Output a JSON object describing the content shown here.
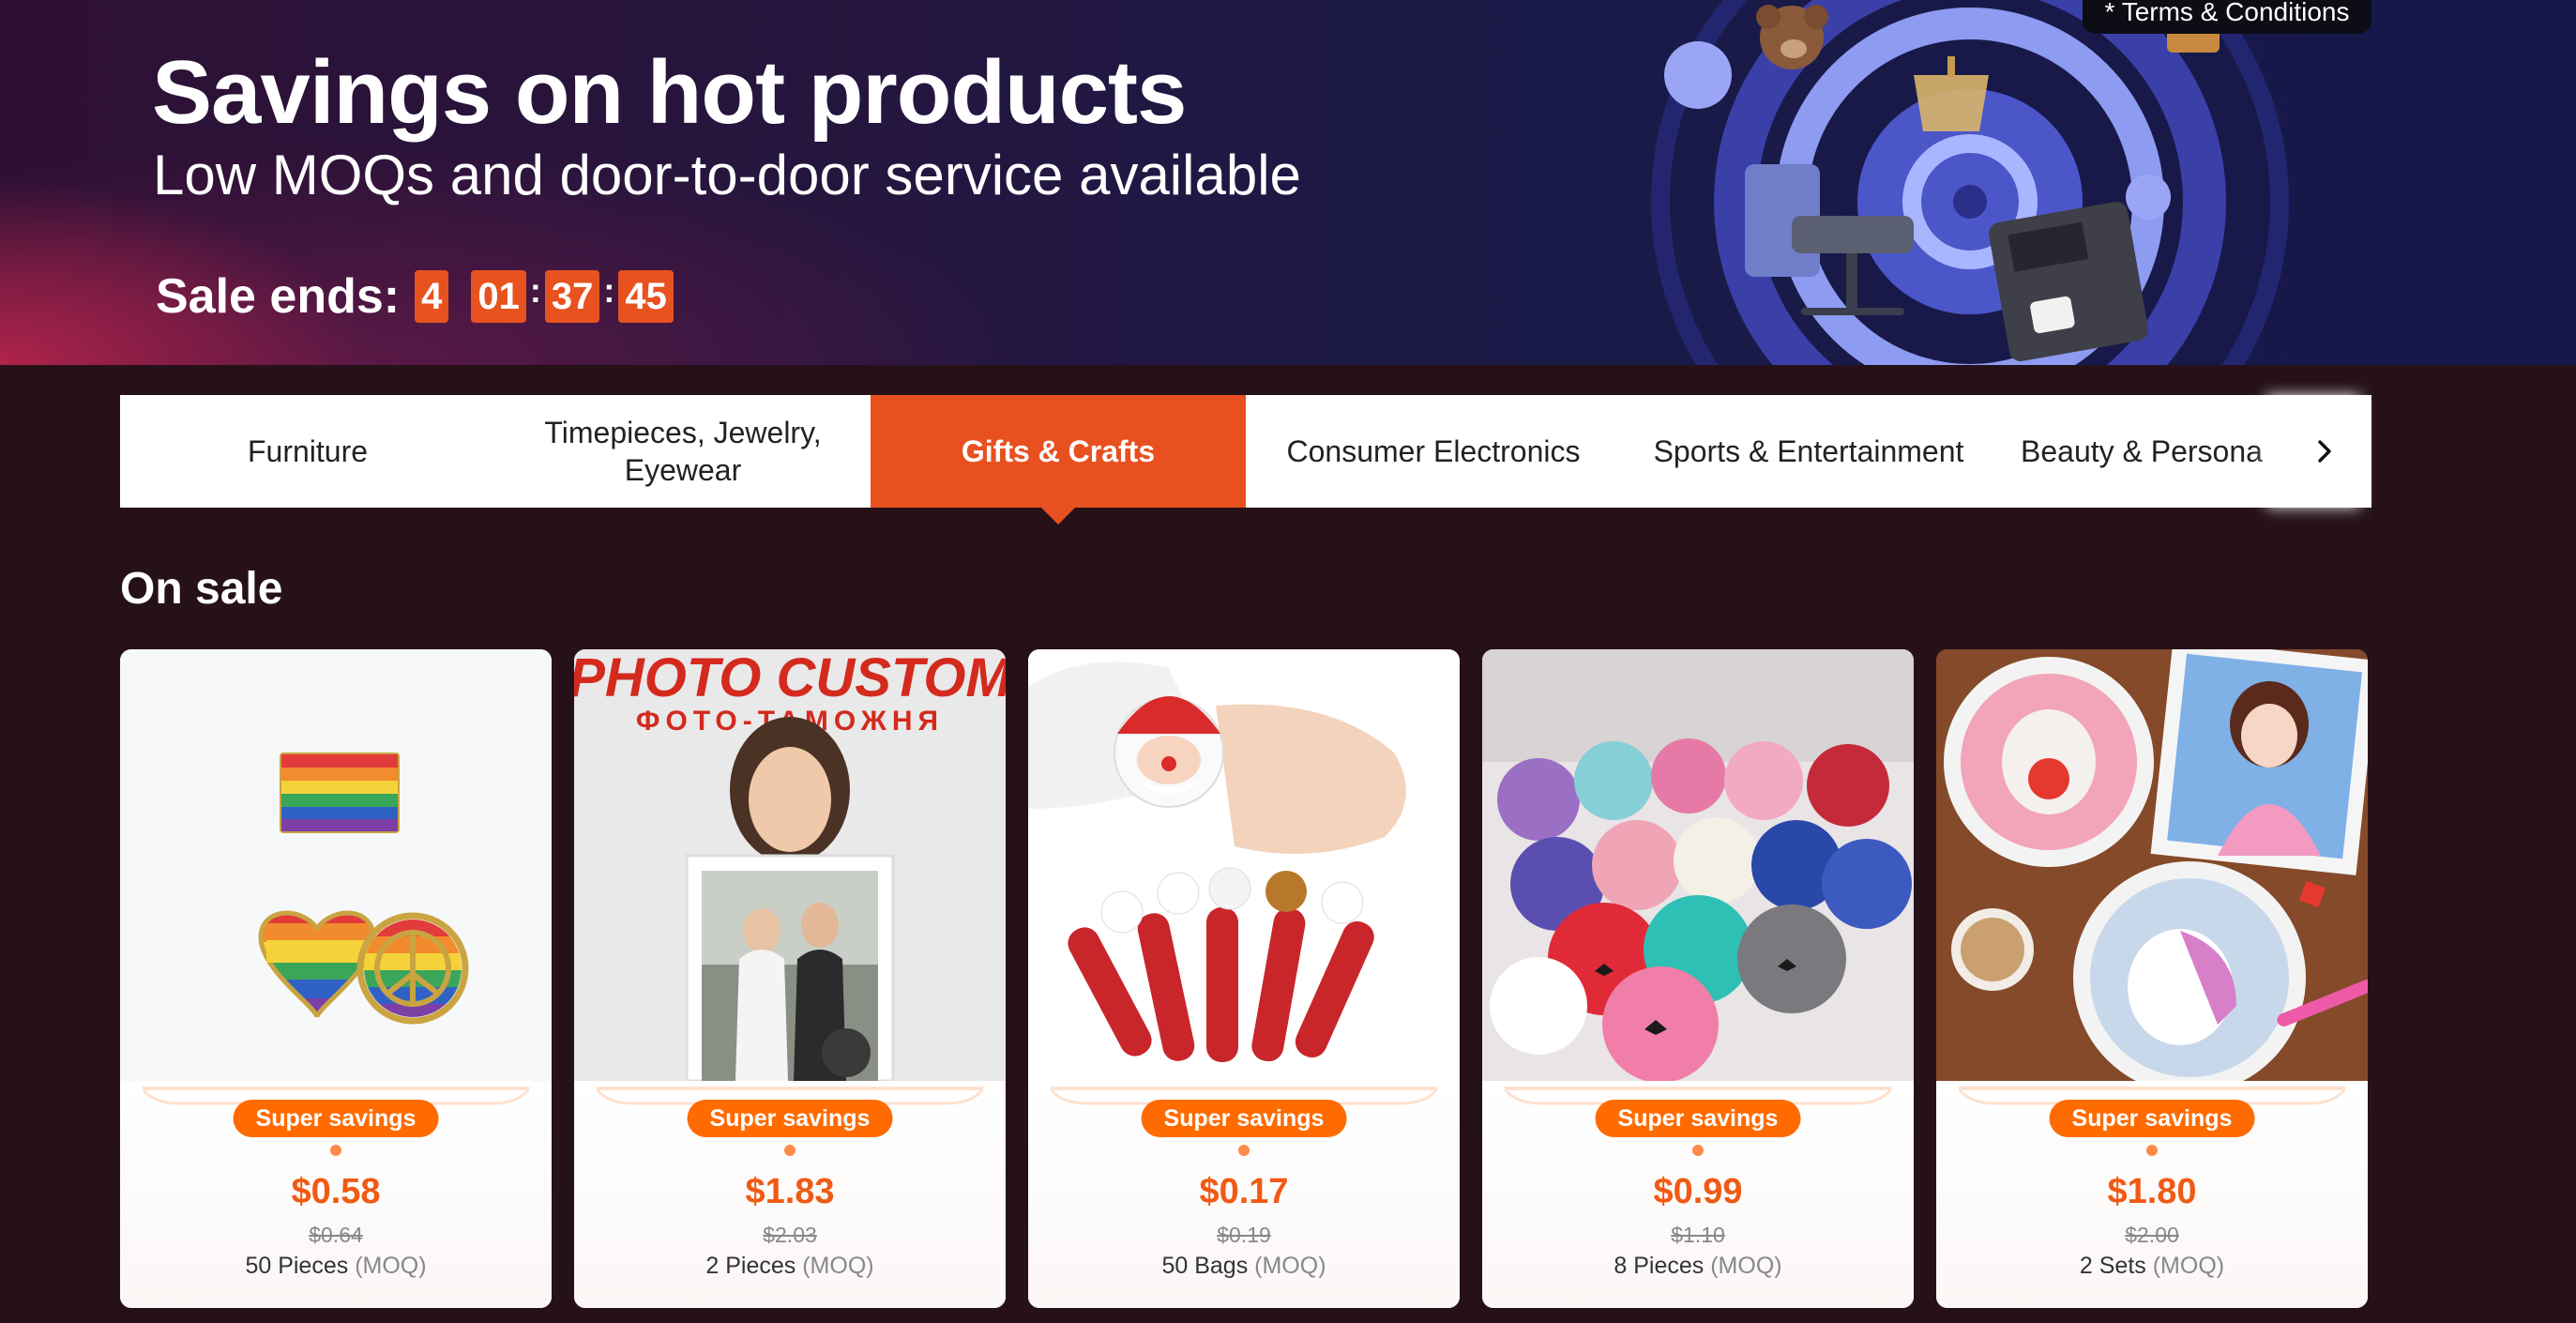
{
  "banner": {
    "title": "Savings on hot products",
    "subtitle": "Low MOQs and door-to-door service available",
    "countdown": {
      "label": "Sale ends:",
      "days": "4",
      "hours": "01",
      "minutes": "37",
      "seconds": "45",
      "separator": ":"
    },
    "terms": "* Terms & Conditions"
  },
  "categories": [
    {
      "label": "Furniture",
      "active": false
    },
    {
      "label": "Timepieces, Jewelry, Eyewear",
      "active": false
    },
    {
      "label": "Gifts & Crafts",
      "active": true
    },
    {
      "label": "Consumer Electronics",
      "active": false
    },
    {
      "label": "Sports & Entertainment",
      "active": false
    },
    {
      "label": "Beauty & Persona",
      "active": false
    }
  ],
  "section": {
    "title": "On sale"
  },
  "products": [
    {
      "badge": "Super savings",
      "price": "$0.58",
      "old_price": "$0.64",
      "moq": "50 Pieces",
      "moq_tag": "(MOQ)",
      "image": "rainbow-pride-pins"
    },
    {
      "badge": "Super savings",
      "price": "$1.83",
      "old_price": "$2.03",
      "moq": "2 Pieces",
      "moq_tag": "(MOQ)",
      "image": "photo-custom-portrait",
      "image_text": {
        "title": "PHOTO CUSTOM",
        "subtitle": "ФОТО-ТАМОЖНЯ"
      }
    },
    {
      "badge": "Super savings",
      "price": "$0.17",
      "old_price": "$0.19",
      "moq": "50 Bags",
      "moq_tag": "(MOQ)",
      "image": "christmas-slap-bracelets"
    },
    {
      "badge": "Super savings",
      "price": "$0.99",
      "old_price": "$1.10",
      "moq": "8 Pieces",
      "moq_tag": "(MOQ)",
      "image": "rose-bears"
    },
    {
      "badge": "Super savings",
      "price": "$1.80",
      "old_price": "$2.00",
      "moq": "2 Sets",
      "moq_tag": "(MOQ)",
      "image": "diamond-painting-kit"
    }
  ],
  "colors": {
    "accent": "#e8501f",
    "price": "#f05a14",
    "badge": "#ff6b00",
    "page_bg": "#261119"
  },
  "icons": {
    "tabs_next": "chevron-right-icon"
  }
}
